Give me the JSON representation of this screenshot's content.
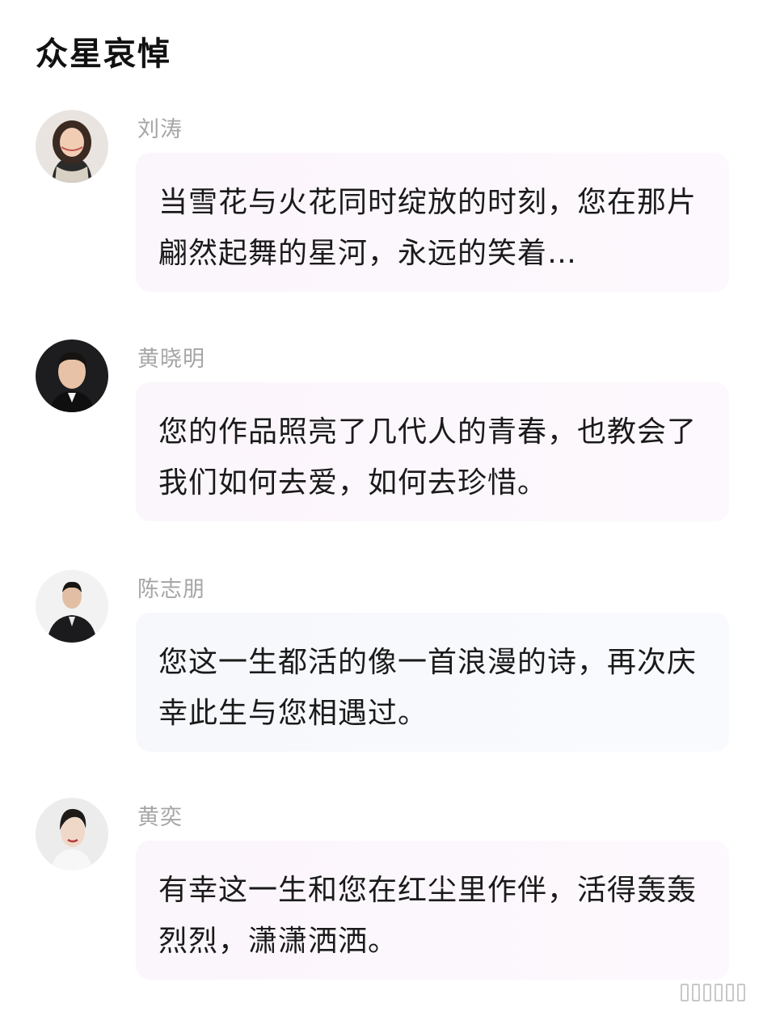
{
  "page": {
    "title": "众星哀悼"
  },
  "messages": [
    {
      "author": "刘涛",
      "text": "当雪花与火花同时绽放的时刻，您在那片翩然起舞的星河，永远的笑着…",
      "avatar_icon": "person-portrait-female",
      "bubble_color": "#fbf6fb"
    },
    {
      "author": "黄晓明",
      "text": "您的作品照亮了几代人的青春，也教会了我们如何去爱，如何去珍惜。",
      "avatar_icon": "person-portrait-male",
      "bubble_color": "#fbf6fb"
    },
    {
      "author": "陈志朋",
      "text": "您这一生都活的像一首浪漫的诗，再次庆幸此生与您相遇过。",
      "avatar_icon": "person-portrait-male-suit",
      "bubble_color": "#f6f8fc"
    },
    {
      "author": "黄奕",
      "text": "有幸这一生和您在红尘里作伴，活得轰轰烈烈，潇潇洒洒。",
      "avatar_icon": "person-portrait-female",
      "bubble_color": "#fbf6fb"
    }
  ],
  "colors": {
    "title": "#111111",
    "author": "#a6a6a6",
    "text": "#1a1a1a",
    "bubble_pink": "#fbf6fb",
    "bubble_blue": "#f6f8fc"
  }
}
